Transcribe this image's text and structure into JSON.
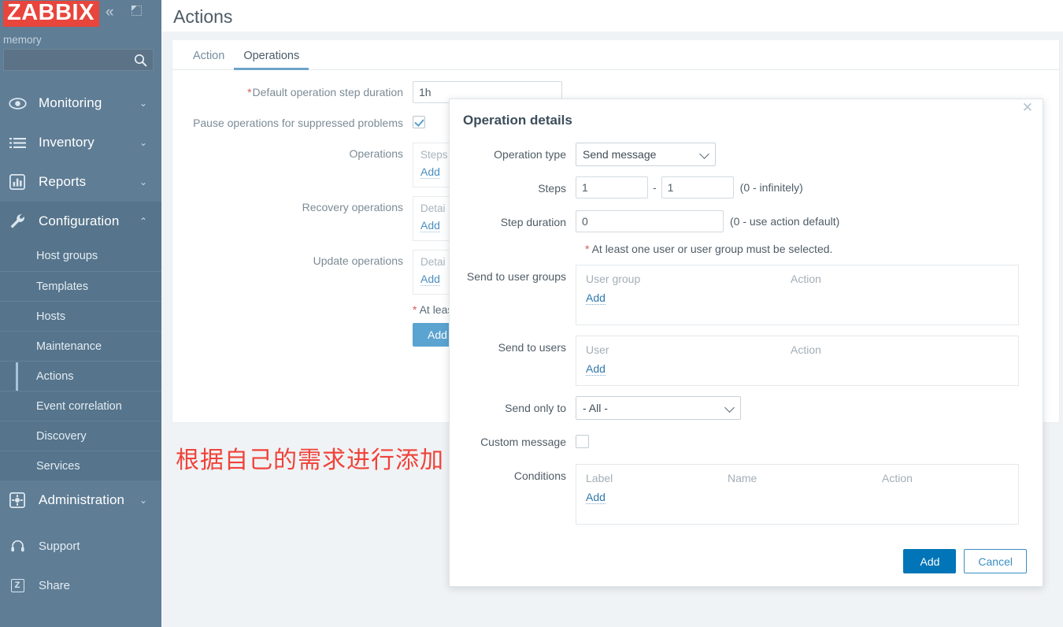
{
  "sidebar": {
    "logo": "ZABBIX",
    "collapse_icon": "chevron-double-left-icon",
    "compact_icon": "compact-view-icon",
    "memory_label": "memory",
    "search_placeholder": "",
    "search_value": "",
    "nav": [
      {
        "label": "Monitoring",
        "icon": "eye-icon",
        "chevron": "⌄"
      },
      {
        "label": "Inventory",
        "icon": "list-icon",
        "chevron": "⌄"
      },
      {
        "label": "Reports",
        "icon": "bar-chart-icon",
        "chevron": "⌄"
      },
      {
        "label": "Configuration",
        "icon": "wrench-icon",
        "chevron": "⌃"
      }
    ],
    "subnav": [
      {
        "label": "Host groups",
        "selected": false
      },
      {
        "label": "Templates",
        "selected": false
      },
      {
        "label": "Hosts",
        "selected": false
      },
      {
        "label": "Maintenance",
        "selected": false
      },
      {
        "label": "Actions",
        "selected": true
      },
      {
        "label": "Event correlation",
        "selected": false
      },
      {
        "label": "Discovery",
        "selected": false
      },
      {
        "label": "Services",
        "selected": false
      }
    ],
    "admin": {
      "label": "Administration",
      "icon": "gear-icon",
      "chevron": "⌄"
    },
    "bottom": [
      {
        "label": "Support",
        "icon": "headset-icon"
      },
      {
        "label": "Share",
        "icon": "zabbix-z-icon",
        "glyph": "Z"
      }
    ]
  },
  "page": {
    "title": "Actions",
    "tabs": [
      {
        "label": "Action",
        "active": false
      },
      {
        "label": "Operations",
        "active": true
      }
    ],
    "fields": {
      "default_step_duration_label": "Default operation step duration",
      "default_step_duration_value": "1h",
      "pause_label": "Pause operations for suppressed problems",
      "pause_checked": true,
      "operations_label": "Operations",
      "operations_header": "Steps",
      "recovery_label": "Recovery operations",
      "recovery_header": "Detai",
      "update_label": "Update operations",
      "update_header": "Detai",
      "add_link": "Add"
    },
    "note": "At least on",
    "buttons": {
      "add": "Add"
    },
    "annotation": "根据自己的需求进行添加"
  },
  "modal": {
    "title": "Operation details",
    "close_icon": "close-icon",
    "operation_type": {
      "label": "Operation type",
      "value": "Send message"
    },
    "steps": {
      "label": "Steps",
      "from": "1",
      "to": "1",
      "dash": "-",
      "hint": "(0 - infinitely)"
    },
    "step_duration": {
      "label": "Step duration",
      "value": "0",
      "hint": "(0 - use action default)"
    },
    "required_note": "At least one user or user group must be selected.",
    "user_groups": {
      "label": "Send to user groups",
      "col_name": "User group",
      "col_action": "Action",
      "add": "Add"
    },
    "users": {
      "label": "Send to users",
      "col_name": "User",
      "col_action": "Action",
      "add": "Add"
    },
    "send_only_to": {
      "label": "Send only to",
      "value": "- All -"
    },
    "custom_message": {
      "label": "Custom message",
      "checked": false
    },
    "conditions": {
      "label": "Conditions",
      "col_label": "Label",
      "col_name": "Name",
      "col_action": "Action",
      "add": "Add"
    },
    "footer": {
      "add": "Add",
      "cancel": "Cancel"
    }
  },
  "colors": {
    "sidebar_bg": "#5f7d95",
    "logo_red": "#e8453c",
    "accent_blue": "#0275b8",
    "tab_active": "#6ca3c9",
    "annotation_red": "#f0433a"
  }
}
